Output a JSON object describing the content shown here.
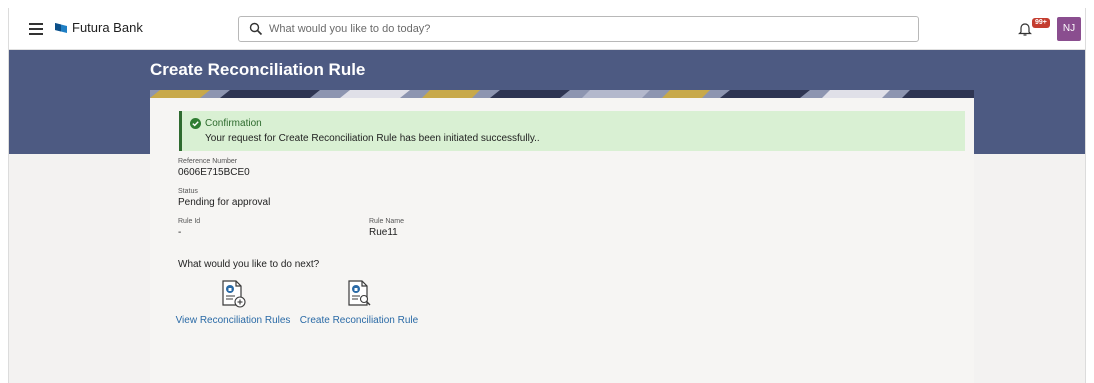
{
  "header": {
    "brand": "Futura Bank",
    "search_placeholder": "What would you like to do today?",
    "notification_badge": "99+",
    "avatar_initials": "NJ"
  },
  "page": {
    "title": "Create Reconciliation Rule"
  },
  "confirmation": {
    "title": "Confirmation",
    "message": "Your request for Create Reconciliation Rule has been initiated successfully.."
  },
  "details": {
    "reference_label": "Reference Number",
    "reference_value": "0606E715BCE0",
    "status_label": "Status",
    "status_value": "Pending for approval",
    "rule_id_label": "Rule Id",
    "rule_id_value": "-",
    "rule_name_label": "Rule Name",
    "rule_name_value": "Rue11"
  },
  "next_steps": {
    "prompt": "What would you like to do next?",
    "actions": [
      {
        "label": "View Reconciliation Rules",
        "icon": "document-add-icon"
      },
      {
        "label": "Create Reconciliation Rule",
        "icon": "document-search-icon"
      }
    ]
  },
  "colors": {
    "hero": "#4d5a82",
    "confirm_bg": "#d9f0d3",
    "confirm_accent": "#2f6b30",
    "link": "#2a6aa6",
    "avatar": "#8a4e8f",
    "badge": "#c43d2f"
  }
}
